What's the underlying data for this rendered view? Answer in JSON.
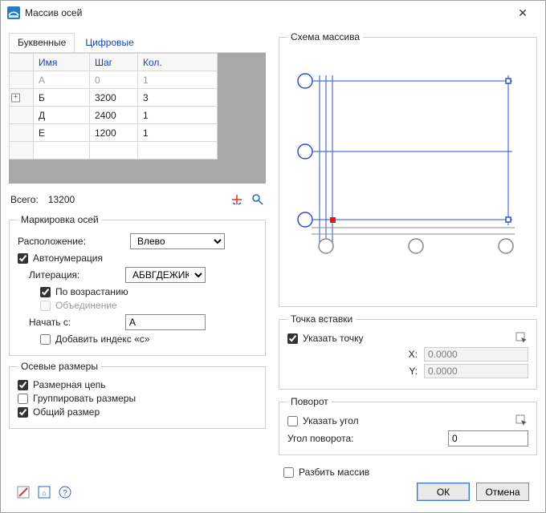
{
  "window": {
    "title": "Массив осей"
  },
  "tabs": {
    "letter": "Буквенные",
    "digit": "Цифровые"
  },
  "grid": {
    "headers": {
      "name": "Имя",
      "step": "Шаг",
      "count": "Кол."
    },
    "rows": [
      {
        "name": "А",
        "step": "0",
        "count": "1",
        "disabled": true
      },
      {
        "name": "Б",
        "step": "3200",
        "count": "3",
        "expandable": true
      },
      {
        "name": "Д",
        "step": "2400",
        "count": "1"
      },
      {
        "name": "Е",
        "step": "1200",
        "count": "1"
      }
    ]
  },
  "total": {
    "label": "Всего:",
    "value": "13200"
  },
  "marking": {
    "legend": "Маркировка осей",
    "location_label": "Расположение:",
    "location_value": "Влево",
    "autonum": "Автонумерация",
    "lettering_label": "Литерация:",
    "lettering_value": "АБВГДЕЖИК",
    "ascending": "По возрастанию",
    "merge": "Объединение",
    "start_label": "Начать с:",
    "start_value": "А",
    "add_index": "Добавить индекс «с»"
  },
  "dims": {
    "legend": "Осевые размеры",
    "chain": "Размерная цепь",
    "group": "Группировать размеры",
    "overall": "Общий размер"
  },
  "scheme": {
    "legend": "Схема массива"
  },
  "insert": {
    "legend": "Точка вставки",
    "pick": "Указать точку",
    "x_label": "X:",
    "x_value": "0.0000",
    "y_label": "Y:",
    "y_value": "0.0000"
  },
  "rotation": {
    "legend": "Поворот",
    "pick": "Указать угол",
    "angle_label": "Угол поворота:",
    "angle_value": "0"
  },
  "split": {
    "label": "Разбить массив"
  },
  "buttons": {
    "ok": "ОК",
    "cancel": "Отмена"
  }
}
